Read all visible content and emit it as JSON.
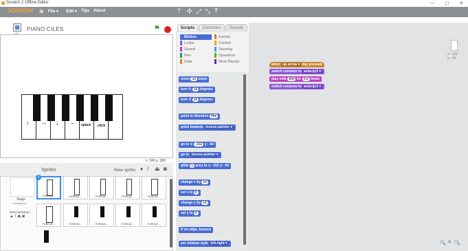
{
  "window": {
    "title": "Scratch 2 Offline Editor",
    "controls": [
      "–",
      "□",
      "×"
    ]
  },
  "menubar": {
    "logo": "SCRATCH",
    "items": [
      "File ▾",
      "Edit ▾",
      "Tips",
      "About"
    ],
    "tools": [
      "⍑",
      "✣",
      "⤢",
      "⤡",
      "?"
    ]
  },
  "stage": {
    "sprite_name": "PIANO CILES",
    "version": "v457",
    "coords": "x: 240  y: 180",
    "keys": {
      "arrow_up": "↑",
      "arrow_right": "→",
      "arrow_down": "↓",
      "arrow_left": "←",
      "space": "space",
      "click": "click"
    }
  },
  "sprites": {
    "header": "Sprites",
    "new_sprite_label": "New sprite:",
    "stage_label": "Stage",
    "stage_backdrops": "1 backdrop",
    "new_backdrop_label": "New backdrop:",
    "thumbs": [
      "Avtecijc...",
      "Avtecijc...",
      "Avtecijc...",
      "Avtecijc...",
      "Avtecijc...",
      "Avtecijc...",
      "Avtecijc...",
      "Avtecijc..."
    ],
    "selected_index_label": "i"
  },
  "tabs": [
    "Scripts",
    "Costumes",
    "Sounds"
  ],
  "categories": [
    {
      "name": "Motion",
      "color": "#4a6cd4"
    },
    {
      "name": "Events",
      "color": "#c88330"
    },
    {
      "name": "Looks",
      "color": "#8a55d7"
    },
    {
      "name": "Control",
      "color": "#e1a91a"
    },
    {
      "name": "Sound",
      "color": "#bb42c3"
    },
    {
      "name": "Sensing",
      "color": "#2ca5e2"
    },
    {
      "name": "Pen",
      "color": "#0e9a6c"
    },
    {
      "name": "Operators",
      "color": "#5cb712"
    },
    {
      "name": "Data",
      "color": "#ee7d16"
    },
    {
      "name": "More Blocks",
      "color": "#632d99"
    }
  ],
  "palette_blocks": [
    {
      "text": "move",
      "val": "10",
      "tail": "steps"
    },
    {
      "text": "turn ↻",
      "val": "15",
      "tail": "degrees"
    },
    {
      "text": "turn ↺",
      "val": "15",
      "tail": "degrees"
    },
    {
      "text": "point in direction",
      "val": "90▾",
      "tail": ""
    },
    {
      "text": "point towards",
      "val": "mouse-pointer ▾",
      "tail": ""
    },
    {
      "text": "go to x:",
      "val": "-152",
      "tail": "y: -54"
    },
    {
      "text": "go to",
      "val": "mouse-pointer ▾",
      "tail": ""
    },
    {
      "text": "glide",
      "val": "1",
      "tail": "secs to x: -152 y: -54"
    },
    {
      "text": "change x by",
      "val": "10",
      "tail": ""
    },
    {
      "text": "set x to",
      "val": "0",
      "tail": ""
    },
    {
      "text": "change y by",
      "val": "10",
      "tail": ""
    },
    {
      "text": "set y to",
      "val": "0",
      "tail": ""
    },
    {
      "text": "if on edge, bounce",
      "val": "",
      "tail": ""
    },
    {
      "text": "set rotation style",
      "val": "left-right ▾",
      "tail": ""
    }
  ],
  "script": {
    "hat": {
      "pre": "when",
      "key": "up arrow ▾",
      "post": "key pressed"
    },
    "b1": {
      "pre": "switch costume to",
      "val": "avtecijc2 ▾"
    },
    "b2": {
      "pre": "play note",
      "val": "60▾",
      "mid": "for",
      "val2": "0.5",
      "post": "beats"
    },
    "b3": {
      "pre": "switch costume to",
      "val": "avtecijc1 ▾"
    }
  },
  "sprite_info": {
    "x": "x: -152",
    "y": "y: -54"
  },
  "zoom": [
    "🔍",
    "=",
    "🔍"
  ]
}
